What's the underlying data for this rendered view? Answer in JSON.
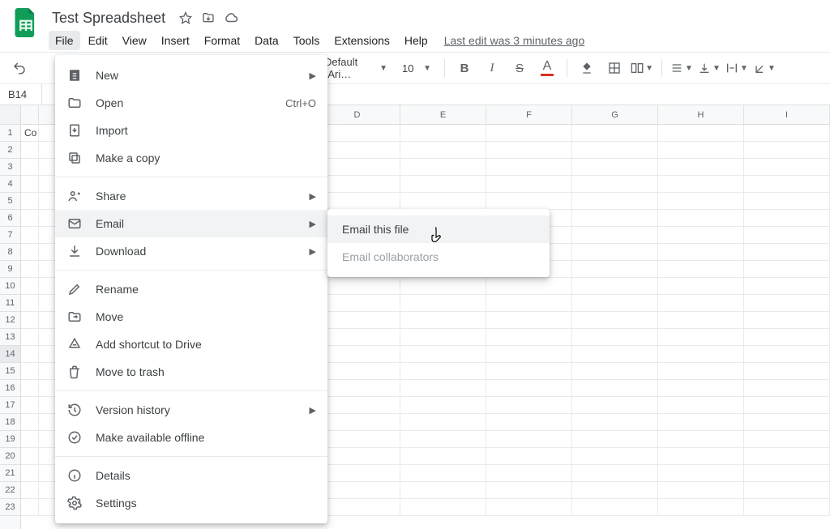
{
  "doc": {
    "title": "Test Spreadsheet"
  },
  "menubar": {
    "items": [
      "File",
      "Edit",
      "View",
      "Insert",
      "Format",
      "Data",
      "Tools",
      "Extensions",
      "Help"
    ],
    "last_edit": "Last edit was 3 minutes ago"
  },
  "toolbar": {
    "font": "Default (Ari…",
    "size": "10"
  },
  "namebox": "B14",
  "cellA1": "Co",
  "columns": [
    "D",
    "E",
    "F",
    "G",
    "H",
    "I"
  ],
  "rows_visible": 23,
  "file_menu": {
    "new": "New",
    "open": "Open",
    "open_shortcut": "Ctrl+O",
    "import": "Import",
    "make_copy": "Make a copy",
    "share": "Share",
    "email": "Email",
    "download": "Download",
    "rename": "Rename",
    "move": "Move",
    "add_shortcut": "Add shortcut to Drive",
    "move_trash": "Move to trash",
    "version_history": "Version history",
    "available_offline": "Make available offline",
    "details": "Details",
    "settings": "Settings"
  },
  "email_submenu": {
    "email_file": "Email this file",
    "email_collab": "Email collaborators"
  }
}
